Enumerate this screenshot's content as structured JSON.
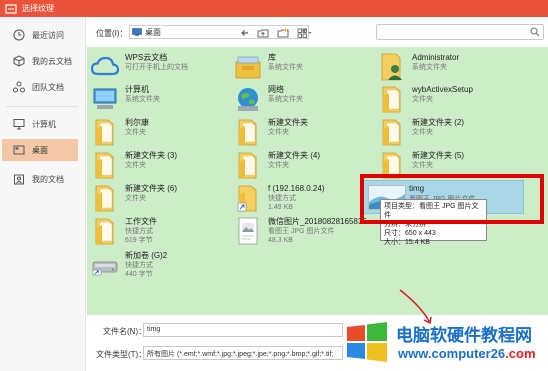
{
  "window": {
    "title": "选择纹理"
  },
  "sidebar": {
    "items": [
      {
        "label": "最近访问",
        "icon": "clock-icon",
        "active": false
      },
      {
        "label": "我的云文档",
        "icon": "cube-icon",
        "active": false
      },
      {
        "label": "团队文档",
        "icon": "team-icon",
        "active": false
      },
      {
        "label": "计算机",
        "icon": "monitor-icon",
        "active": false
      },
      {
        "label": "桌面",
        "icon": "desktop-icon",
        "active": true
      },
      {
        "label": "我的文档",
        "icon": "document-icon",
        "active": false
      }
    ]
  },
  "toolbar": {
    "location_label": "位置(I)：",
    "location_value": "桌面"
  },
  "files": [
    {
      "name": "WPS云文档",
      "sub": "可打开手机上的文档",
      "icon": "cloud-icon"
    },
    {
      "name": "库",
      "sub": "系统文件夹",
      "icon": "library-icon"
    },
    {
      "name": "Administrator",
      "sub": "系统文件夹",
      "icon": "user-folder-icon"
    },
    {
      "name": "计算机",
      "sub": "系统文件夹",
      "icon": "computer-icon"
    },
    {
      "name": "网络",
      "sub": "系统文件夹",
      "icon": "network-icon"
    },
    {
      "name": "wybActivexSetup",
      "sub": "文件夹",
      "icon": "folder-icon"
    },
    {
      "name": "利尔康",
      "sub": "文件夹",
      "icon": "folder-icon"
    },
    {
      "name": "新建文件夹",
      "sub": "文件夹",
      "icon": "folder-icon"
    },
    {
      "name": "新建文件夹 (2)",
      "sub": "文件夹",
      "icon": "folder-icon"
    },
    {
      "name": "新建文件夹 (3)",
      "sub": "文件夹",
      "icon": "folder-icon"
    },
    {
      "name": "新建文件夹 (4)",
      "sub": "文件夹",
      "icon": "folder-icon"
    },
    {
      "name": "新建文件夹 (5)",
      "sub": "文件夹",
      "icon": "folder-icon"
    },
    {
      "name": "新建文件夹 (6)",
      "sub": "文件夹",
      "icon": "folder-icon"
    },
    {
      "name": "f (192.168.0.24)",
      "sub": "快捷方式",
      "sub2": "1.49 KB",
      "icon": "shortcut-folder-icon"
    },
    {
      "name": "工作文件",
      "sub": "快捷方式",
      "sub2": "619 字节",
      "icon": "folder-icon"
    },
    {
      "name": "微信图片_20180828165835",
      "sub": "看图王 JPG 图片文件",
      "sub2": "48.3 KB",
      "icon": "image-file-icon"
    },
    {
      "name": "新加卷 (G)2",
      "sub": "快捷方式",
      "sub2": "440 字节",
      "icon": "drive-icon"
    }
  ],
  "selected": {
    "name": "timg",
    "sub": "看图王 JPG 图片文件",
    "size_dims": "尺寸：650 x 443",
    "size": "大小：15.4 KB"
  },
  "tooltip": {
    "line1": "项目类型：看图王 JPG 图片文件",
    "line2": "分辨：未分辨"
  },
  "footer": {
    "filename_label": "文件名(N)：",
    "filename_value": "timg",
    "filetype_label": "文件类型(T)：",
    "filetype_value": "所有图片 (*.emf;*.wmf;*.jpg;*.jpeg;*.jpe;*.png;*.bmp;*.gif;*.tif;"
  },
  "watermark": {
    "title": "电脑软硬件教程网",
    "url_prefix": "www.computer26",
    "url_suffix": ".com"
  }
}
